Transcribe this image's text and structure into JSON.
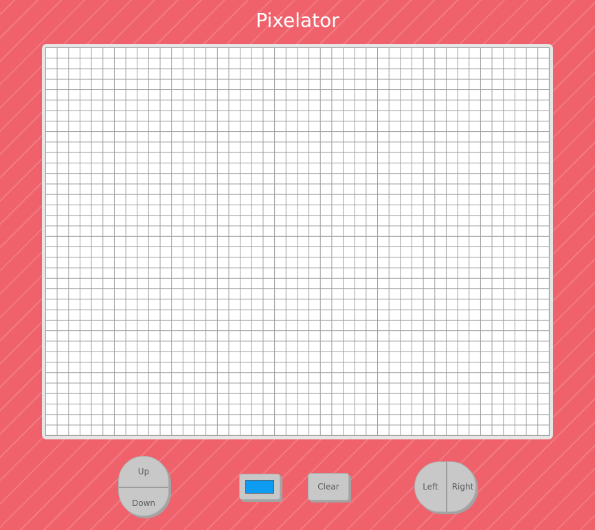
{
  "app": {
    "title": "Pixelator"
  },
  "grid": {
    "columns": 44,
    "rows": 37,
    "line_color": "#9c9c9c",
    "cell_color": "#ffffff"
  },
  "controls": {
    "up_label": "Up",
    "down_label": "Down",
    "left_label": "Left",
    "right_label": "Right",
    "clear_label": "Clear",
    "current_color": "#0e9cf2"
  },
  "theme": {
    "background": "#ef626c",
    "button": "#c8c8c8"
  }
}
